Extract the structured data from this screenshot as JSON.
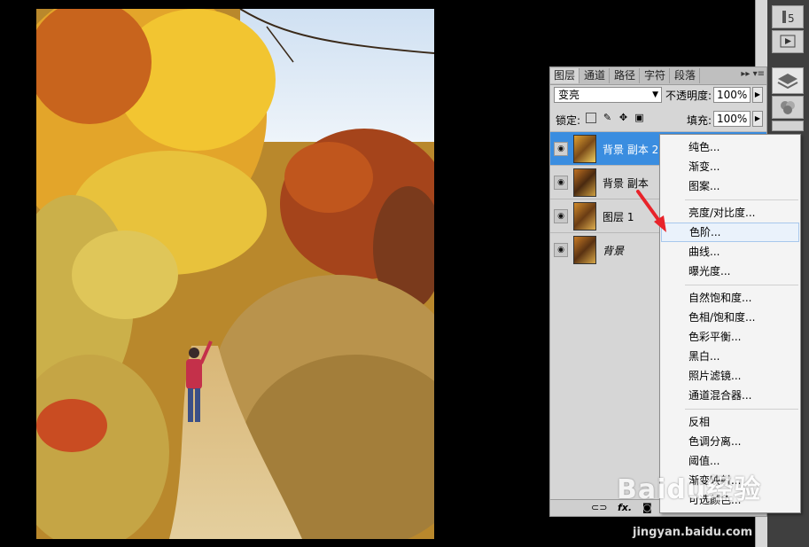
{
  "panel": {
    "tabs": [
      "图层",
      "通道",
      "路径",
      "字符",
      "段落"
    ],
    "menu_glyph": "▸▸ ▾≡",
    "blend_mode": "变亮",
    "opacity_label": "不透明度:",
    "opacity_value": "100%",
    "lock_label": "锁定:",
    "fill_label": "填充:",
    "fill_value": "100%",
    "layers": [
      {
        "name": "背景 副本 2",
        "selected": true
      },
      {
        "name": "背景 副本",
        "selected": false
      },
      {
        "name": "图层 1",
        "selected": false
      },
      {
        "name": "背景",
        "selected": false,
        "italic": true
      }
    ],
    "bottom_fx": "fx."
  },
  "context_menu": {
    "items": [
      "纯色...",
      "渐变...",
      "图案...",
      "亮度/对比度...",
      "色阶...",
      "曲线...",
      "曝光度...",
      "自然饱和度...",
      "色相/饱和度...",
      "色彩平衡...",
      "黑白...",
      "照片滤镜...",
      "通道混合器...",
      "反相",
      "色调分离...",
      "阈值...",
      "渐变映射...",
      "可选颜色..."
    ],
    "hover_item": "色阶..."
  },
  "watermark": {
    "logo": "Baidu经验",
    "url": "jingyan.baidu.com"
  },
  "colors": {
    "selection": "#3a8de0",
    "menu_hover": "#eaf2fb",
    "arrow": "#e8232a"
  }
}
